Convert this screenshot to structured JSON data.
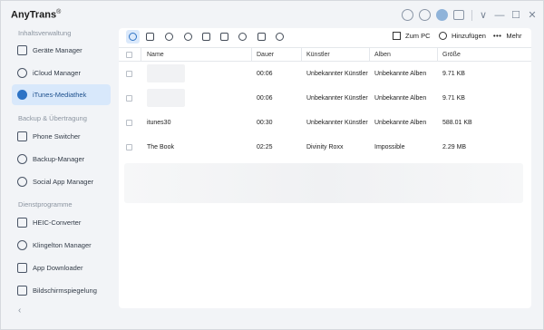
{
  "app": {
    "title": "AnyTrans",
    "reg_mark": "®"
  },
  "window_controls": {
    "icons": [
      "mail-icon",
      "search-icon",
      "avatar",
      "shirt-icon"
    ],
    "buttons": [
      "chevron-down-icon",
      "minimize-icon",
      "maximize-icon",
      "close-icon"
    ],
    "chevron": "∨",
    "minimize": "—",
    "maximize": "☐",
    "close": "✕"
  },
  "sidebar": {
    "sections": [
      {
        "title": "Inhaltsverwaltung",
        "items": [
          {
            "label": "Geräte Manager",
            "icon": "device-icon",
            "active": false
          },
          {
            "label": "iCloud Manager",
            "icon": "cloud-icon",
            "active": false
          },
          {
            "label": "iTunes-Mediathek",
            "icon": "itunes-icon",
            "active": true
          }
        ]
      },
      {
        "title": "Backup & Übertragung",
        "items": [
          {
            "label": "Phone Switcher",
            "icon": "phone-switch-icon",
            "active": false
          },
          {
            "label": "Backup-Manager",
            "icon": "backup-icon",
            "active": false
          },
          {
            "label": "Social App Manager",
            "icon": "chat-icon",
            "active": false
          }
        ]
      },
      {
        "title": "Dienstprogramme",
        "items": [
          {
            "label": "HEIC-Converter",
            "icon": "heic-icon",
            "active": false
          },
          {
            "label": "Klingelton Manager",
            "icon": "bell-icon",
            "active": false
          },
          {
            "label": "App Downloader",
            "icon": "app-store-icon",
            "active": false
          },
          {
            "label": "Bildschirmspiegelung",
            "icon": "mirror-icon",
            "active": false
          }
        ]
      }
    ],
    "collapse_arrow": "‹"
  },
  "toolbar": {
    "category_icons": [
      {
        "name": "music-icon",
        "active": true
      },
      {
        "name": "playlist-icon",
        "active": false
      },
      {
        "name": "ringtone-icon",
        "active": false
      },
      {
        "name": "audiobook-icon",
        "active": false
      },
      {
        "name": "movie-icon",
        "active": false
      },
      {
        "name": "tv-show-icon",
        "active": false
      },
      {
        "name": "podcast-icon",
        "active": false
      },
      {
        "name": "itunes-u-icon",
        "active": false
      },
      {
        "name": "voice-memo-icon",
        "active": false
      }
    ],
    "actions": {
      "to_pc": "Zum PC",
      "add": "Hinzufügen",
      "more": "Mehr",
      "more_dots": "•••"
    }
  },
  "table": {
    "columns": {
      "name": "Name",
      "duration": "Dauer",
      "artist": "Künstler",
      "album": "Alben",
      "size": "Größe"
    },
    "rows": [
      {
        "name": "",
        "duration": "00:06",
        "artist": "Unbekannter Künstler",
        "album": "Unbekannte Alben",
        "size": "9.71 KB",
        "thumb": true
      },
      {
        "name": "",
        "duration": "00:06",
        "artist": "Unbekannter Künstler",
        "album": "Unbekannte Alben",
        "size": "9.71 KB",
        "thumb": true
      },
      {
        "name": "itunes30",
        "duration": "00:30",
        "artist": "Unbekannter Künstler",
        "album": "Unbekannte Alben",
        "size": "588.01 KB",
        "thumb": false
      },
      {
        "name": "The Book",
        "duration": "02:25",
        "artist": "Divinity Roxx",
        "album": "Impossible",
        "size": "2.29 MB",
        "thumb": false
      }
    ]
  }
}
